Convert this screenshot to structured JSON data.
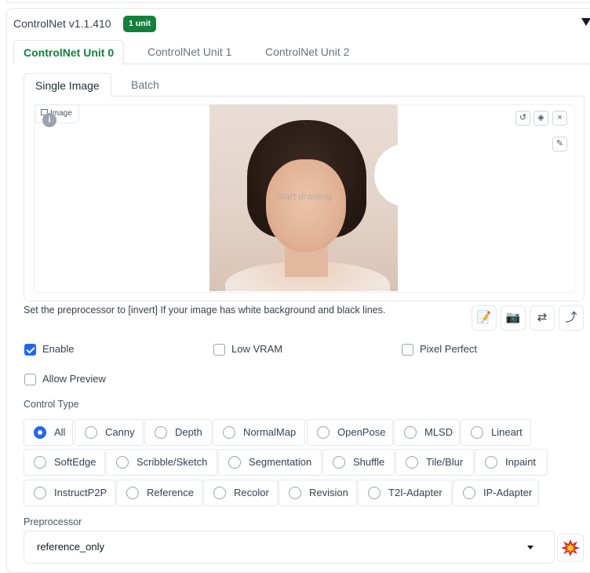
{
  "header": {
    "title": "ControlNet v1.1.410",
    "badge": "1 unit"
  },
  "unit_tabs": [
    {
      "label": "ControlNet Unit 0",
      "active": true
    },
    {
      "label": "ControlNet Unit 1",
      "active": false
    },
    {
      "label": "ControlNet Unit 2",
      "active": false
    }
  ],
  "image_tabs": [
    {
      "label": "Single Image",
      "active": true
    },
    {
      "label": "Batch",
      "active": false
    }
  ],
  "canvas": {
    "image_label": "Image",
    "overlay_text": "Start drawing",
    "tools": [
      "undo-icon",
      "eraser-icon",
      "close-icon",
      "brush-icon"
    ]
  },
  "hint": "Set the preprocessor to [invert] If your image has white background and black lines.",
  "actions": [
    "edit-icon",
    "camera-icon",
    "swap-icon",
    "send-icon"
  ],
  "options": {
    "enable": {
      "label": "Enable",
      "checked": true
    },
    "low_vram": {
      "label": "Low VRAM",
      "checked": false
    },
    "pixel_perfect": {
      "label": "Pixel Perfect",
      "checked": false
    },
    "allow_preview": {
      "label": "Allow Preview",
      "checked": false
    }
  },
  "control_type": {
    "label": "Control Type",
    "selected": "All",
    "rows": [
      [
        "All",
        "Canny",
        "Depth",
        "NormalMap",
        "OpenPose",
        "MLSD",
        "Lineart"
      ],
      [
        "SoftEdge",
        "Scribble/Sketch",
        "Segmentation",
        "Shuffle",
        "Tile/Blur",
        "Inpaint"
      ],
      [
        "InstructP2P",
        "Reference",
        "Recolor",
        "Revision",
        "T2I-Adapter",
        "IP-Adapter"
      ]
    ]
  },
  "preprocessor": {
    "label": "Preprocessor",
    "value": "reference_only",
    "run_icon": "explosion-icon"
  },
  "colors": {
    "accent_green": "#15803d",
    "accent_blue": "#2563eb",
    "border": "#e5e7eb"
  }
}
